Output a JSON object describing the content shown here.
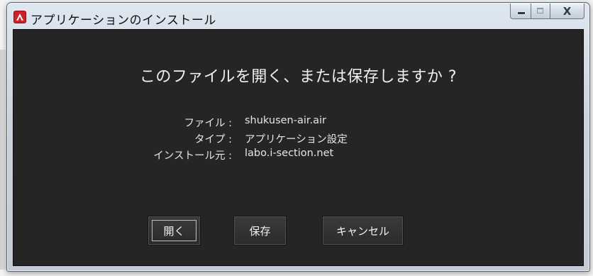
{
  "window": {
    "title": "アプリケーションのインストール",
    "caption": {
      "minimize_icon": "minimize-icon",
      "maximize_icon": "maximize-icon",
      "close_glyph": "X"
    },
    "app_icon": "adobe-air-icon",
    "app_icon_color": "#d31f25"
  },
  "dialog": {
    "question": "このファイルを開く、または保存しますか ?",
    "info": [
      {
        "label": "ファイル :",
        "value": "shukusen-air.air"
      },
      {
        "label": "タイプ :",
        "value": "アプリケーション設定"
      },
      {
        "label": "インストール元 :",
        "value": "labo.i-section.net"
      }
    ],
    "buttons": {
      "open": "開く",
      "save": "保存",
      "cancel": "キャンセル"
    }
  },
  "colors": {
    "dialog_bg": "#252525",
    "text": "#f0f0f0",
    "frame": "#c8d3de"
  }
}
